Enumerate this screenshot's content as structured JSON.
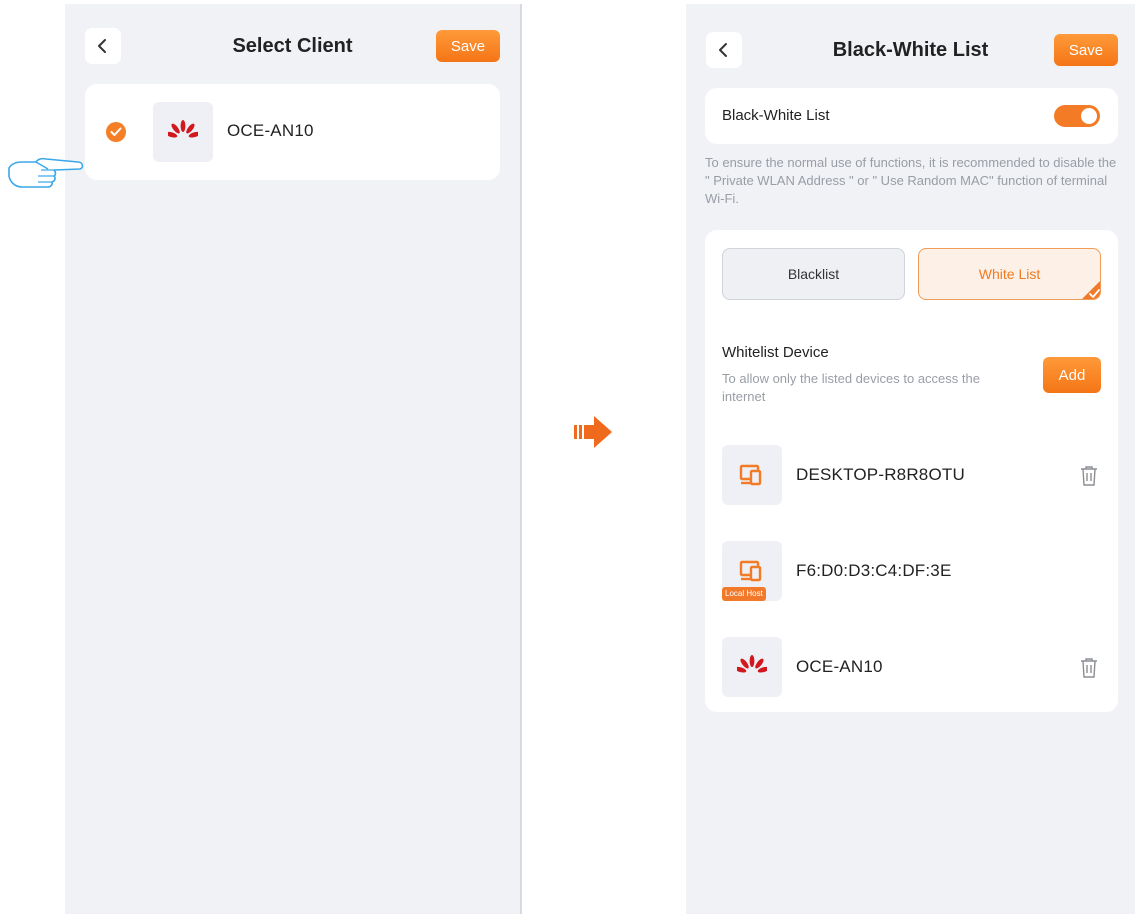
{
  "select_client": {
    "title": "Select Client",
    "save_label": "Save",
    "clients": [
      {
        "name": "OCE-AN10",
        "icon": "huawei-logo-icon",
        "selected": true
      }
    ]
  },
  "black_white": {
    "title": "Black-White List",
    "save_label": "Save",
    "toggle_label": "Black-White List",
    "toggle_on": true,
    "hint": "To ensure the normal use of functions, it is recommended to disable the \" Private WLAN Address \" or \" Use Random MAC\" function of terminal Wi-Fi.",
    "tabs": {
      "blacklist": "Blacklist",
      "whitelist": "White List",
      "selected": "whitelist"
    },
    "whitelist_title": "Whitelist Device",
    "whitelist_desc": "To allow only the listed devices to access the internet",
    "add_label": "Add",
    "devices": [
      {
        "name": "DESKTOP-R8R8OTU",
        "icon": "computer-icon",
        "badge": "",
        "deletable": true
      },
      {
        "name": "F6:D0:D3:C4:DF:3E",
        "icon": "computer-icon",
        "badge": "Local Host",
        "deletable": false
      },
      {
        "name": "OCE-AN10",
        "icon": "huawei-logo-icon",
        "badge": "",
        "deletable": true
      }
    ]
  },
  "colors": {
    "accent": "#f47b26",
    "background": "#f1f2f6",
    "card": "#ffffff"
  },
  "decor": {
    "pointer": "hand-pointer-icon",
    "arrow": "right-arrow-icon"
  }
}
